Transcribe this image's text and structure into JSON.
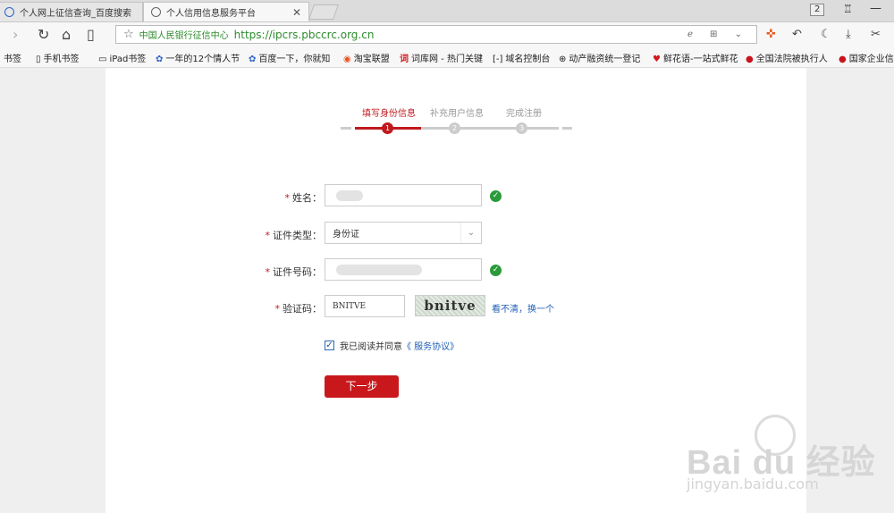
{
  "browser": {
    "tabs": [
      {
        "title": "个人网上征信查询_百度搜索",
        "active": false
      },
      {
        "title": "个人信用信息服务平台",
        "active": true
      }
    ],
    "tab_count": "2",
    "address": {
      "cert_label": "中国人民银行征信中心",
      "url": "https://ipcrs.pbccrc.org.cn"
    },
    "bookmarks": [
      {
        "label": "书签",
        "icon": "bookmark-icon"
      },
      {
        "label": "手机书签",
        "icon": "phone-icon"
      },
      {
        "label": "iPad书签",
        "icon": "tablet-icon"
      },
      {
        "label": "一年的12个情人节",
        "icon": "baidu-paw-icon"
      },
      {
        "label": "百度一下，你就知",
        "icon": "baidu-paw-icon"
      },
      {
        "label": "淘宝联盟",
        "icon": "taobao-icon"
      },
      {
        "label": "词库网 - 热门关键",
        "icon": "ciku-icon"
      },
      {
        "label": "域名控制台",
        "icon": "console-icon"
      },
      {
        "label": "动产融资统一登记",
        "icon": "globe-icon"
      },
      {
        "label": "鲜花语-一站式鲜花",
        "icon": "heart-icon"
      },
      {
        "label": "全国法院被执行人",
        "icon": "emblem-icon"
      },
      {
        "label": "国家企业信",
        "icon": "emblem-icon"
      }
    ]
  },
  "steps": [
    {
      "label": "填写身份信息",
      "number": "1",
      "active": true
    },
    {
      "label": "补充用户信息",
      "number": "2",
      "active": false
    },
    {
      "label": "完成注册",
      "number": "3",
      "active": false
    }
  ],
  "form": {
    "required_mark": "*",
    "name_label": "姓名：",
    "id_type_label": "证件类型：",
    "id_type_value": "身份证",
    "id_number_label": "证件号码：",
    "captcha_label": "验证码：",
    "captcha_value": "BNITVE",
    "captcha_image_text": "bnitve",
    "captcha_refresh": "看不清，换一个",
    "agree_text": "我已阅读并同意",
    "agree_link": "《 服务协议》",
    "agree_checked": true,
    "next_button": "下一步"
  },
  "watermark": {
    "logo": "Bai du 经验",
    "sub": "jingyan.baidu.com"
  },
  "colors": {
    "accent": "#c9181c",
    "ok": "#2a9a3a",
    "link": "#1f5fb5",
    "secure_url": "#2e8b2e"
  }
}
